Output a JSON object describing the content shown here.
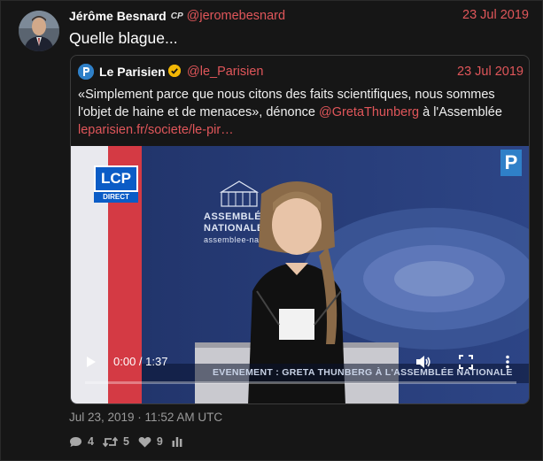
{
  "tweet": {
    "author_name": "Jérôme Besnard",
    "author_badge": "CP",
    "author_handle": "@jeromebesnard",
    "date": "23 Jul 2019",
    "text": "Quelle blague..."
  },
  "quoted": {
    "name": "Le Parisien",
    "handle": "@le_Parisien",
    "date": "23 Jul 2019",
    "text_before": "«Simplement parce que nous citons des faits scientifiques, nous sommes l'objet de haine et de menaces», dénonce ",
    "mention": "@GretaThunberg",
    "text_after": " à l'Assemblée ",
    "link": "leparisien.fr/societe/le-pir…"
  },
  "video": {
    "lcp_logo": "LCP",
    "lcp_direct": "DIRECT",
    "assembly_line1": "ASSEMBLÉE",
    "assembly_line2": "NATIONALE",
    "assembly_url": "assemblee-nationale",
    "caption": "EVENEMENT : GRETA THUNBERG À L'ASSEMBLÉE NATIONALE",
    "brand_logo": "P",
    "time": "0:00 / 1:37",
    "progress": 0
  },
  "footer": {
    "timestamp": "Jul 23, 2019 · 11:52 AM UTC",
    "replies": "4",
    "retweets": "5",
    "likes": "9"
  },
  "colors": {
    "accent": "#e0565a",
    "background": "#161616",
    "muted": "#9a9a9a"
  }
}
